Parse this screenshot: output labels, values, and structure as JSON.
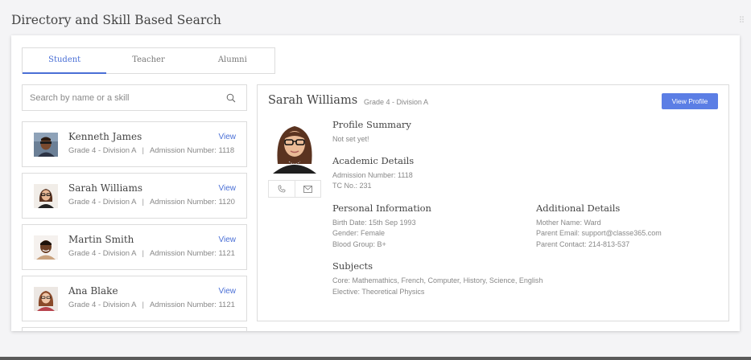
{
  "page": {
    "title": "Directory and Skill Based Search"
  },
  "tabs": [
    {
      "label": "Student",
      "active": true
    },
    {
      "label": "Teacher",
      "active": false
    },
    {
      "label": "Alumni",
      "active": false
    }
  ],
  "search": {
    "placeholder": "Search by name or a skill",
    "value": "",
    "icon": "search-icon"
  },
  "students": [
    {
      "name": "Kenneth James",
      "grade": "Grade 4 - Division A",
      "separator": "|",
      "admission": "Admission Number: 1118",
      "view_label": "View"
    },
    {
      "name": "Sarah Williams",
      "grade": "Grade 4 - Division A",
      "separator": "|",
      "admission": "Admission Number: 1120",
      "view_label": "View"
    },
    {
      "name": "Martin Smith",
      "grade": "Grade 4 - Division A",
      "separator": "|",
      "admission": "Admission Number: 1121",
      "view_label": "View"
    },
    {
      "name": "Ana Blake",
      "grade": "Grade 4 - Division A",
      "separator": "|",
      "admission": "Admission Number: 1121",
      "view_label": "View"
    }
  ],
  "profile": {
    "name": "Sarah Williams",
    "grade": "Grade 4 - Division A",
    "view_profile_label": "View Profile",
    "contact_icons": [
      "phone-icon",
      "mail-icon"
    ],
    "summary": {
      "heading": "Profile Summary",
      "text": "Not set yet!"
    },
    "academic": {
      "heading": "Academic Details",
      "admission": "Admission Number: 1118",
      "tc": "TC No.: 231"
    },
    "personal": {
      "heading": "Personal Information",
      "birth": "Birth Date: 15th Sep 1993",
      "gender": "Gender: Female",
      "blood": "Blood Group: B+"
    },
    "additional": {
      "heading": "Additional Details",
      "mother": "Mother Name: Ward",
      "email": "Parent Email: support@classe365.com",
      "contact": "Parent Contact: 214-813-537"
    },
    "subjects": {
      "heading": "Subjects",
      "core": "Core: Mathemathics, French, Computer, History, Science, English",
      "elective": "Elective: Theoretical Physics"
    }
  },
  "colors": {
    "accent": "#4a6fd6",
    "button": "#5b7ee5",
    "border": "#dcdcdc"
  }
}
